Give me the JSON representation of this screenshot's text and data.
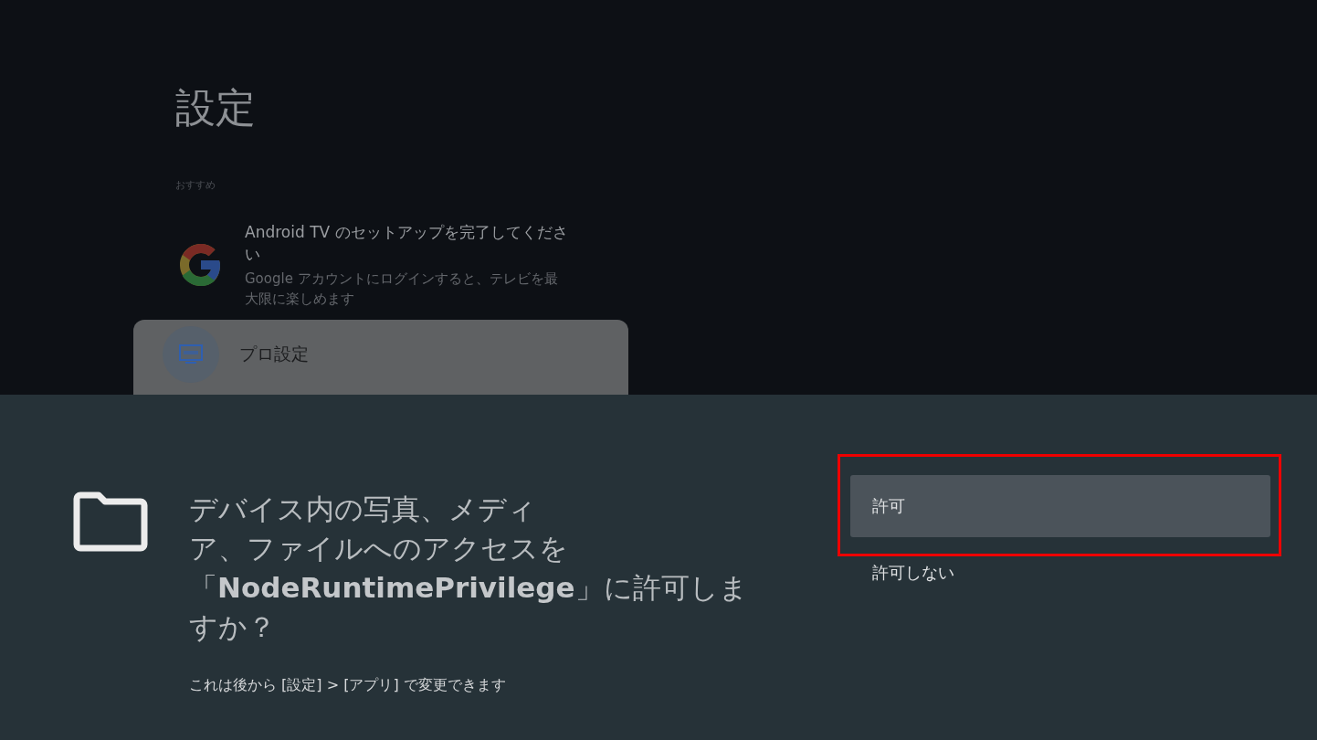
{
  "screen_title": "設定",
  "section_label": "おすすめ",
  "suggestion": {
    "title": "Android TV のセットアップを完了してください",
    "subtitle": "Google アカウントにログインすると、テレビを最大限に楽しめます"
  },
  "menu_items": [
    {
      "label": "プロ設定",
      "selected": true
    }
  ],
  "dialog": {
    "question_lines": [
      "デバイス内の写真、メディ",
      "ア、ファイルへのアクセスを",
      "「**NodeRuntimePrivilege**」に許可しま",
      "すか？"
    ],
    "note": "これは後から [設定] > [アプリ] で変更できます",
    "options": [
      {
        "label": "許可",
        "selected": true,
        "highlighted": true
      },
      {
        "label": "許可しない",
        "selected": false,
        "highlighted": false
      }
    ]
  }
}
